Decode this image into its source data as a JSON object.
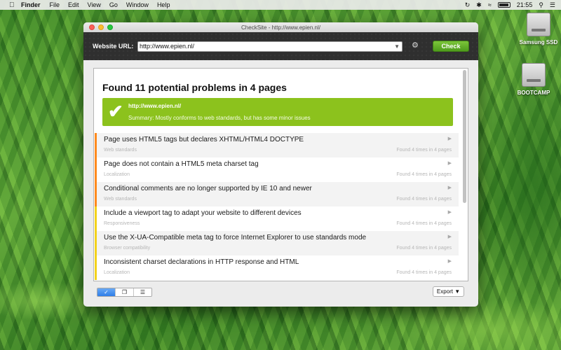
{
  "menubar": {
    "apple_icon": "apple-icon",
    "app_name": "Finder",
    "items": [
      "File",
      "Edit",
      "View",
      "Go",
      "Window",
      "Help"
    ],
    "clock": "21:55"
  },
  "desktop": {
    "drives": [
      {
        "label": "Samsung SSD"
      },
      {
        "label": "BOOTCAMP"
      }
    ]
  },
  "window": {
    "title": "CheckSite - http://www.epien.nl/"
  },
  "toolbar": {
    "url_label": "Website URL:",
    "url_value": "http://www.epien.nl/",
    "check_label": "Check"
  },
  "results": {
    "heading": "Found 11 potential problems in 4 pages",
    "summary_url": "http://www.epien.nl/",
    "summary_text": "Summary: Mostly conforms to web standards, but has some minor issues",
    "summary_color": "#8cc21d",
    "issues": [
      {
        "title": "Page uses HTML5 tags but declares XHTML/HTML4 DOCTYPE",
        "category": "Web standards",
        "count": "Found 4 times in 4 pages",
        "severity": "orange"
      },
      {
        "title": "Page does not contain a HTML5 meta charset tag",
        "category": "Localization",
        "count": "Found 4 times in 4 pages",
        "severity": "orange"
      },
      {
        "title": "Conditional comments are no longer supported by IE 10 and newer",
        "category": "Web standards",
        "count": "Found 4 times in 4 pages",
        "severity": "orange"
      },
      {
        "title": "Include a viewport tag to adapt your website to different devices",
        "category": "Responsiveness",
        "count": "Found 4 times in 4 pages",
        "severity": "yellow"
      },
      {
        "title": "Use the X-UA-Compatible meta tag to force Internet Explorer to use standards mode",
        "category": "Browser compatibility",
        "count": "Found 4 times in 4 pages",
        "severity": "yellow"
      },
      {
        "title": "Inconsistent charset declarations in HTTP response and HTML",
        "category": "Localization",
        "count": "Found 4 times in 4 pages",
        "severity": "yellow"
      }
    ]
  },
  "bottom": {
    "export_label": "Export ▼"
  }
}
